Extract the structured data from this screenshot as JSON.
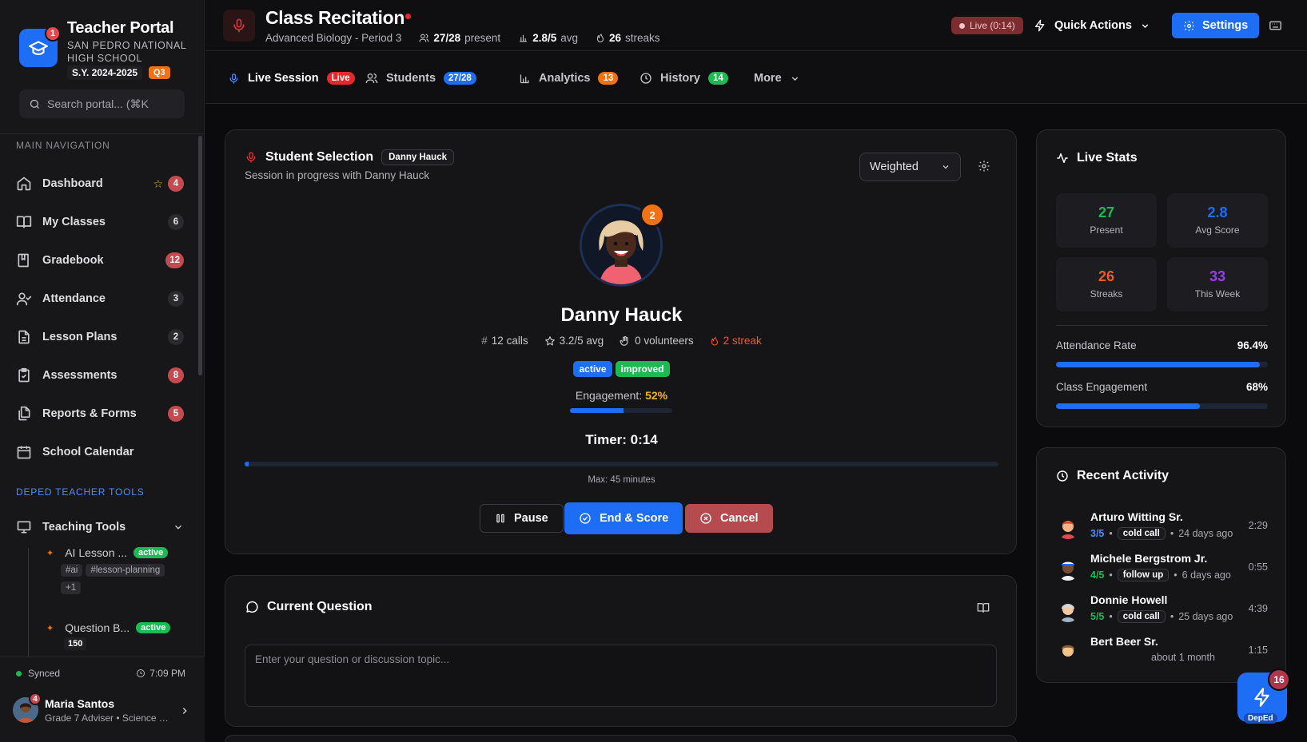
{
  "sidebar": {
    "brand": {
      "title": "Teacher Portal",
      "school": "San Pedro National High School",
      "sy": "S.Y. 2024-2025",
      "quarter": "Q3",
      "badge": "1"
    },
    "search_placeholder": "Search portal... (⌘K",
    "main_nav_label": "MAIN NAVIGATION",
    "items": [
      {
        "label": "Dashboard",
        "count": "4",
        "icon": "home-icon"
      },
      {
        "label": "My Classes",
        "count": "6",
        "icon": "book-open-icon"
      },
      {
        "label": "Gradebook",
        "count": "12",
        "icon": "book-icon"
      },
      {
        "label": "Attendance",
        "count": "3",
        "icon": "user-check-icon"
      },
      {
        "label": "Lesson Plans",
        "count": "2",
        "icon": "file-text-icon"
      },
      {
        "label": "Assessments",
        "count": "8",
        "icon": "clipboard-icon"
      },
      {
        "label": "Reports & Forms",
        "count": "5",
        "icon": "files-icon"
      },
      {
        "label": "School Calendar",
        "count": "",
        "icon": "calendar-icon"
      }
    ],
    "tools_label": "DEPED TEACHER TOOLS",
    "teaching_tools": "Teaching Tools",
    "tools": [
      {
        "name": "AI Lesson ...",
        "status": "active",
        "tags": [
          "#ai",
          "#lesson-planning",
          "+1"
        ]
      },
      {
        "name": "Question B...",
        "status": "active",
        "count": "150"
      }
    ],
    "footer": {
      "sync": "Synced",
      "time": "7:09 PM",
      "user_name": "Maria Santos",
      "user_role": "Grade 7 Adviser • Science Te...",
      "user_badge": "4"
    }
  },
  "header": {
    "title": "Class Recitation",
    "subtitle": "Advanced Biology - Period 3",
    "present": "27/28",
    "present_label": "present",
    "avg": "2.8/5",
    "avg_label": "avg",
    "streaks": "26",
    "streaks_label": "streaks",
    "live": "Live (0:14)",
    "quick_actions": "Quick Actions",
    "settings": "Settings"
  },
  "tabs": [
    {
      "label": "Live Session",
      "badge": "Live"
    },
    {
      "label": "Students",
      "badge": "27/28"
    },
    {
      "label": "Analytics",
      "badge": "13"
    },
    {
      "label": "History",
      "badge": "14"
    },
    {
      "label": "More",
      "badge": ""
    }
  ],
  "selection": {
    "title": "Student Selection",
    "chip": "Danny Hauck",
    "subtitle": "Session in progress with Danny Hauck",
    "mode": "Weighted",
    "avatar_badge": "2",
    "student": "Danny Hauck",
    "calls": "12 calls",
    "avg": "3.2/5 avg",
    "volunteers": "0 volunteers",
    "streak": "2 streak",
    "badges": [
      "active",
      "improved"
    ],
    "engagement_label": "Engagement:",
    "engagement": "52%",
    "engagement_value": 0.52,
    "timer": "Timer: 0:14",
    "timer_progress": 0.005,
    "max": "Max: 45 minutes",
    "pause": "Pause",
    "end": "End & Score",
    "cancel": "Cancel"
  },
  "question": {
    "title": "Current Question",
    "placeholder": "Enter your question or discussion topic..."
  },
  "live_stats": {
    "title": "Live Stats",
    "cards": [
      {
        "value": "27",
        "label": "Present",
        "color": "#1fb954"
      },
      {
        "value": "2.8",
        "label": "Avg Score",
        "color": "#1d6ef5"
      },
      {
        "value": "26",
        "label": "Streaks",
        "color": "#f05a1e"
      },
      {
        "value": "33",
        "label": "This Week",
        "color": "#9b3bf0"
      }
    ],
    "attendance_label": "Attendance Rate",
    "attendance": "96.4%",
    "attendance_value": 0.964,
    "engagement_label": "Class Engagement",
    "engagement": "68%",
    "engagement_value": 0.68
  },
  "activity": {
    "title": "Recent Activity",
    "items": [
      {
        "name": "Arturo Witting Sr.",
        "score": "3/5",
        "score_color": "#4c8dff",
        "type": "cold call",
        "ago": "24 days ago",
        "dur": "2:29"
      },
      {
        "name": "Michele Bergstrom Jr.",
        "score": "4/5",
        "score_color": "#1fb954",
        "type": "follow up",
        "ago": "6 days ago",
        "dur": "0:55"
      },
      {
        "name": "Donnie Howell",
        "score": "5/5",
        "score_color": "#1fb954",
        "type": "cold call",
        "ago": "25 days ago",
        "dur": "4:39"
      },
      {
        "name": "Bert Beer Sr.",
        "score": "",
        "score_color": "#1fb954",
        "type": "",
        "ago": "about 1 month",
        "dur": "1:15"
      }
    ]
  },
  "fab": {
    "badge": "16",
    "label": "DepEd"
  }
}
